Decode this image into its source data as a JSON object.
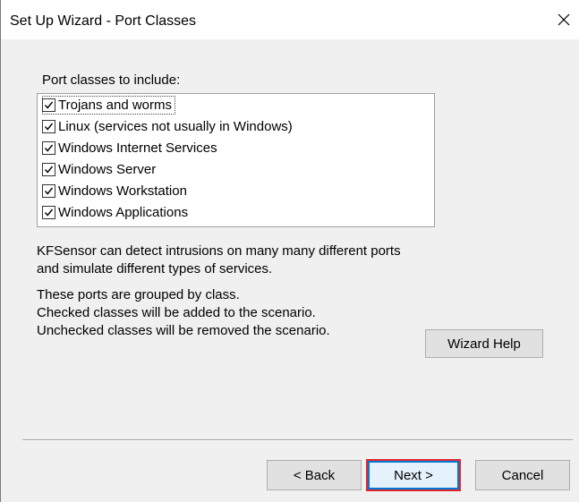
{
  "window": {
    "title": "Set Up Wizard - Port Classes",
    "close_icon": "close-icon"
  },
  "port_classes": {
    "label": "Port classes to include:",
    "items": [
      {
        "label": "Trojans and worms",
        "checked": true
      },
      {
        "label": "Linux (services not usually in Windows)",
        "checked": true
      },
      {
        "label": "Windows Internet Services",
        "checked": true
      },
      {
        "label": "Windows Server",
        "checked": true
      },
      {
        "label": "Windows Workstation",
        "checked": true
      },
      {
        "label": "Windows Applications",
        "checked": true
      }
    ]
  },
  "description": {
    "line1": "KFSensor can detect intrusions on many many different ports",
    "line2": "and simulate different types of services.",
    "line3": "These ports are grouped by class.",
    "line4": "Checked classes will be added to the scenario.",
    "line5": "Unchecked classes will be removed the scenario."
  },
  "buttons": {
    "wizard_help": "Wizard Help",
    "back": "< Back",
    "next": "Next >",
    "cancel": "Cancel"
  },
  "colors": {
    "highlight": "#e0262f",
    "focus_border": "#0078d7"
  }
}
